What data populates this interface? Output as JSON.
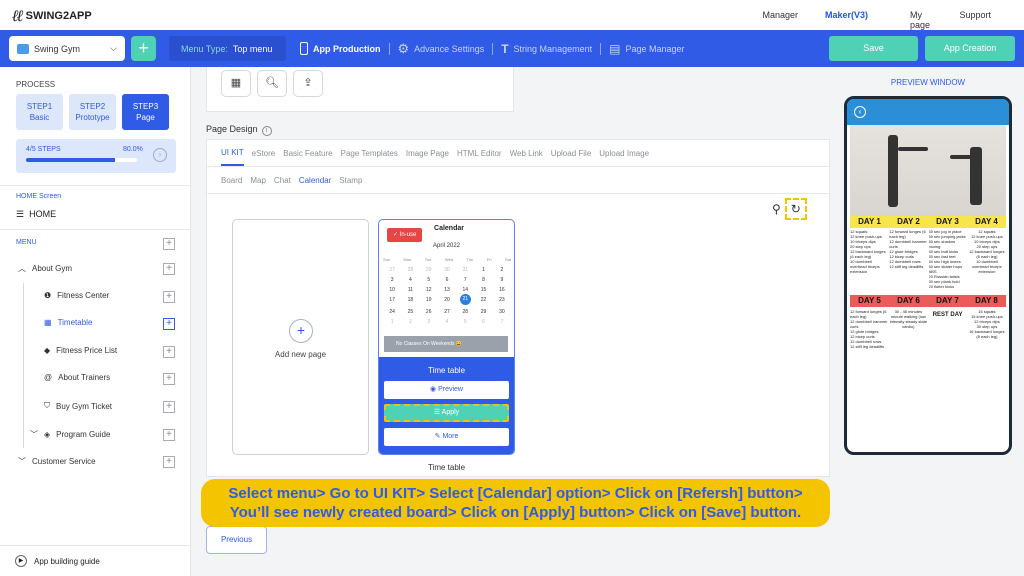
{
  "brand": {
    "name": "SWING2APP"
  },
  "topnav": [
    {
      "label": "Manager",
      "active": false
    },
    {
      "label": "Maker(V3)",
      "active": true
    },
    {
      "label": "My page",
      "active": false
    },
    {
      "label": "Support",
      "active": false
    }
  ],
  "toolbar": {
    "app_name": "Swing Gym",
    "menu_type_label": "Menu Type:",
    "menu_type_value": "Top menu",
    "tabs": [
      "App Production",
      "Advance Settings",
      "String Management",
      "Page Manager"
    ],
    "save_label": "Save",
    "create_label": "App Creation"
  },
  "sidebar": {
    "process_label": "PROCESS",
    "steps": [
      {
        "line1": "STEP1",
        "line2": "Basic"
      },
      {
        "line1": "STEP2",
        "line2": "Prototype"
      },
      {
        "line1": "STEP3",
        "line2": "Page"
      }
    ],
    "progress": {
      "label": "4/5 STEPS",
      "percent_text": "80.0%",
      "value": 0.8
    },
    "home_screen_label": "HOME Screen",
    "home_label": "HOME",
    "menu_label": "MENU",
    "items": [
      {
        "label": "About Gym"
      },
      {
        "label": "Fitness Center"
      },
      {
        "label": "Timetable"
      },
      {
        "label": "Fitness Price List"
      },
      {
        "label": "About Trainers"
      },
      {
        "label": "Buy Gym Ticket"
      },
      {
        "label": "Program Guide"
      },
      {
        "label": "Customer Service"
      }
    ],
    "guide_label": "App building guide"
  },
  "page_design": {
    "label": "Page Design",
    "tabs": [
      "UI KIT",
      "eStore",
      "Basic Feature",
      "Page Templates",
      "Image Page",
      "HTML Editor",
      "Web Link",
      "Upload File",
      "Upload Image"
    ],
    "subtabs": [
      "Board",
      "Map",
      "Chat",
      "Calendar",
      "Stamp"
    ],
    "add_page_label": "Add new page",
    "calendar_card": {
      "in_use": "In-use",
      "title": "Calendar",
      "month": "April 2022",
      "weekdays": [
        "Sun",
        "Mon",
        "Tue",
        "Wed",
        "Thu",
        "Fri",
        "Sat"
      ],
      "days": [
        "27",
        "28",
        "29",
        "30",
        "31",
        "1",
        "2",
        "3",
        "4",
        "5",
        "6",
        "7",
        "8",
        "9",
        "10",
        "11",
        "12",
        "13",
        "14",
        "15",
        "16",
        "17",
        "18",
        "19",
        "20",
        "21",
        "22",
        "23",
        "24",
        "25",
        "26",
        "27",
        "28",
        "29",
        "30",
        "1",
        "2",
        "3",
        "4",
        "5",
        "6",
        "7"
      ],
      "notice": "No Classes On Weekends 😀",
      "bottom_title": "Time table",
      "preview_label": "Preview",
      "apply_label": "Apply",
      "more_label": "More",
      "caption": "Time table"
    }
  },
  "banner": {
    "line1": "Select menu> Go to UI KIT> Select [Calendar] option> Click on [Refersh] button>",
    "line2": "You’ll see newly created board> Click on [Apply] button> Click on [Save] button."
  },
  "previous_label": "Previous",
  "preview": {
    "label": "PREVIEW WINDOW",
    "days_top": [
      "DAY 1",
      "DAY 2",
      "DAY 3",
      "DAY 4"
    ],
    "days_bottom": [
      "DAY 5",
      "DAY 6",
      "DAY 7",
      "DAY 8"
    ],
    "top_cells": [
      "12 squats\n12 knee push-ups\n10 triceps dips\n20 step ups\n12 backward lunges (6 each leg)\n10 dumbbell overhead triceps extension",
      "12 forward lunges (6 each leg)\n12 dumbbell hammer curls\n12 glute bridges\n12 bicep curls\n12 dumbbell rows\n12 stiff leg deadlifts",
      "60 sec jog in place\n60 sec jumping jacks\n60 sec shadow boxing\n60 sec butt kicks\n60 sec fast feet\n60 sec high knees\n60 sec skater hops\nABS\n20 Russian twists\n30 sec plank hold\n20 flutter kicks",
      "12 squats\n12 knee push-ups\n10 triceps dips\n20 step ups\n12 backward lunges (6 each leg)\n10 dumbbell overhead triceps extension"
    ],
    "bottom_cells": [
      "12 forward lunges (6 each leg)\n12 dumbbell hammer curls\n12 glute bridges\n12 bicep curls\n12 dumbbell rows\n12 stiff leg deadlifts",
      "30 - 45 minutes minute walking (low intensity steady state cardio)",
      "REST DAY",
      "15 squats\n15 knee push-ups\n12 triceps dips\n30 step ups\n16 backward lunges (8 each leg)"
    ]
  }
}
